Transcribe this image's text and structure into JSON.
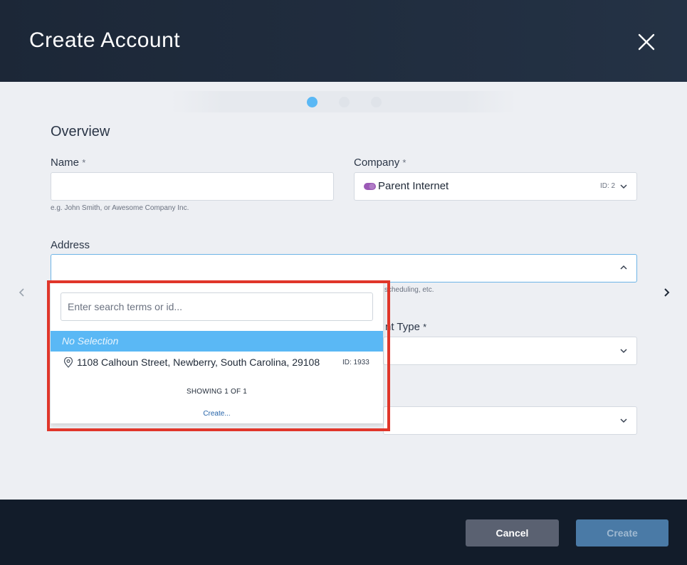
{
  "header": {
    "title": "Create Account"
  },
  "stepper": {
    "steps": 3,
    "active_step": 1
  },
  "section": {
    "title": "Overview"
  },
  "fields": {
    "name": {
      "label": "Name",
      "required_mark": "*",
      "value": "",
      "hint": "e.g. John Smith, or Awesome Company Inc."
    },
    "company": {
      "label": "Company",
      "required_mark": "*",
      "value": "Parent Internet",
      "id_text": "ID: 2"
    },
    "address": {
      "label": "Address",
      "value": "",
      "hint_partial": "scheduling, etc."
    },
    "account_type": {
      "label_partial": "nt Type",
      "required_mark": "*"
    }
  },
  "address_dropdown": {
    "search_placeholder": "Enter search terms or id...",
    "no_selection_label": "No Selection",
    "options": [
      {
        "label": "1108 Calhoun Street, Newberry, South Carolina, 29108",
        "id_text": "ID: 1933"
      }
    ],
    "showing_text": "SHOWING 1 OF 1",
    "create_link": "Create..."
  },
  "footer": {
    "cancel_label": "Cancel",
    "create_label": "Create"
  },
  "colors": {
    "header_bg": "#1c2737",
    "accent": "#5ab8f5",
    "highlight_border": "#e0362a",
    "company_icon": "#9b59b6",
    "footer_bg": "#121c2a"
  }
}
